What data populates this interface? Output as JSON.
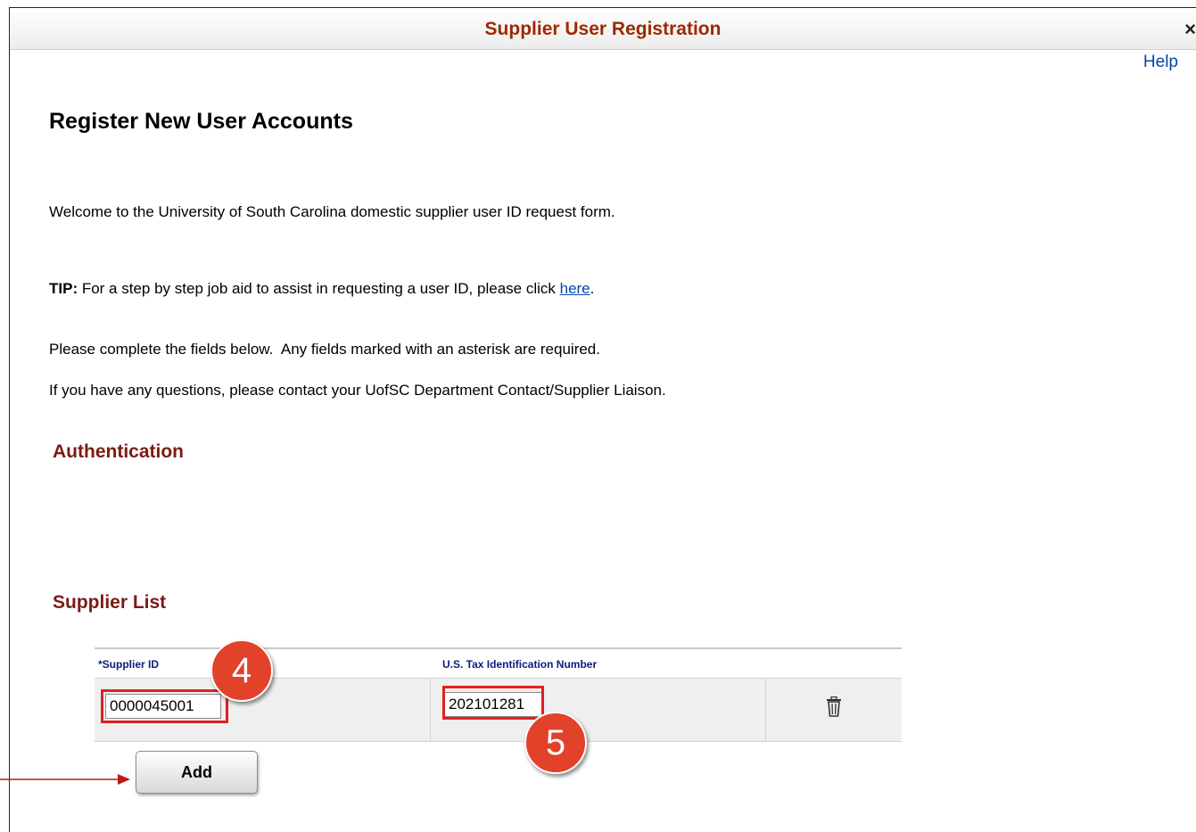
{
  "window": {
    "title": "Supplier User Registration",
    "close_glyph": "×"
  },
  "help_link": "Help",
  "page_heading": "Register New User Accounts",
  "intro": {
    "welcome": "Welcome to the University of South Carolina domestic supplier user ID request form.",
    "tip_label": "TIP:",
    "tip_text": " For a step by step job aid to assist in requesting a user ID, please click ",
    "tip_link": "here",
    "tip_end": ".",
    "instructions": "Please complete the fields below.  Any fields marked with an asterisk are required.",
    "contact": "If you have any questions, please contact your UofSC Department Contact/Supplier Liaison."
  },
  "sections": {
    "authentication": "Authentication",
    "supplier_list": "Supplier List"
  },
  "grid": {
    "columns": [
      "*Supplier ID",
      "U.S. Tax Identification Number"
    ],
    "rows": [
      {
        "supplier_id": "0000045001",
        "tax_id": "202101281"
      }
    ],
    "delete_icon": "trash-icon"
  },
  "add_button": "Add",
  "callouts": [
    "4",
    "5"
  ],
  "colors": {
    "title": "#9c2a00",
    "section": "#7d1a14",
    "link": "#0645ad",
    "callout": "#e2412a",
    "highlight": "#e02020"
  }
}
